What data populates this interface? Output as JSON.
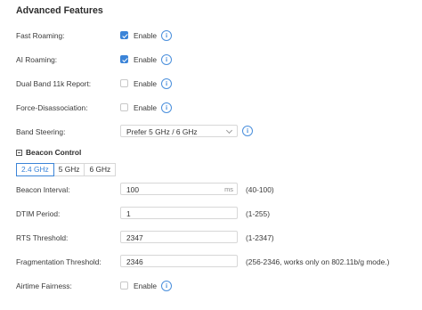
{
  "title": "Advanced Features",
  "enable_label": "Enable",
  "rows": {
    "fast_roaming": {
      "label": "Fast Roaming:",
      "checked": true
    },
    "ai_roaming": {
      "label": "AI Roaming:",
      "checked": true
    },
    "dual_band": {
      "label": "Dual Band 11k Report:",
      "checked": false
    },
    "force_disassoc": {
      "label": "Force-Disassociation:",
      "checked": false
    },
    "airtime": {
      "label": "Airtime Fairness:",
      "checked": false
    }
  },
  "band_steering": {
    "label": "Band Steering:",
    "value": "Prefer 5 GHz / 6 GHz"
  },
  "beacon_section": {
    "title": "Beacon Control"
  },
  "tabs": [
    "2.4 GHz",
    "5 GHz",
    "6 GHz"
  ],
  "active_tab": "2.4 GHz",
  "fields": {
    "beacon_interval": {
      "label": "Beacon Interval:",
      "value": "100",
      "unit": "ms",
      "range": "(40-100)"
    },
    "dtim": {
      "label": "DTIM Period:",
      "value": "1",
      "range": "(1-255)"
    },
    "rts": {
      "label": "RTS Threshold:",
      "value": "2347",
      "range": "(1-2347)"
    },
    "frag": {
      "label": "Fragmentation Threshold:",
      "value": "2346",
      "range": "(256-2346, works only on 802.11b/g mode.)"
    }
  },
  "colors": {
    "accent": "#3b84d8",
    "border": "#d7d7d7"
  },
  "icons": {
    "info": "info-circle-icon",
    "check": "checkbox-check-icon",
    "chevron": "chevron-down-icon",
    "collapse": "collapse-minus-icon"
  }
}
